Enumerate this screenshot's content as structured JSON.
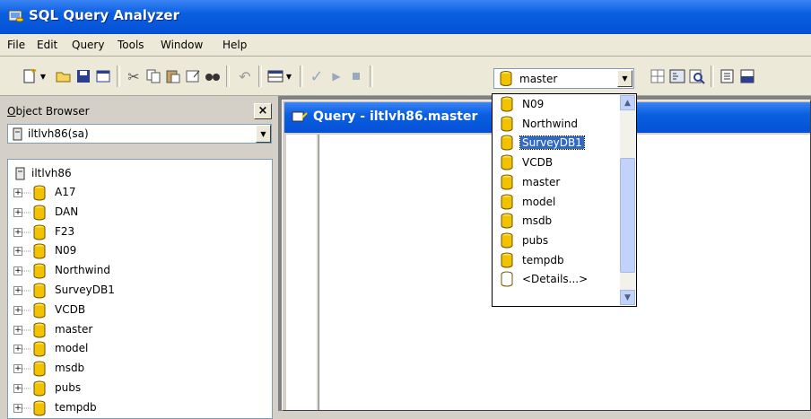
{
  "app": {
    "title": "SQL Query Analyzer"
  },
  "menu": [
    "File",
    "Edit",
    "Query",
    "Tools",
    "Window",
    "Help"
  ],
  "toolbar": {
    "database_selected": "master"
  },
  "object_browser": {
    "header": "Object Browser",
    "header_rest": "bject Browser",
    "header_access": "O",
    "server": "iltlvh86(sa)",
    "root": "iltlvh86",
    "databases": [
      "A17",
      "DAN",
      "F23",
      "N09",
      "Northwind",
      "SurveyDB1",
      "VCDB",
      "master",
      "model",
      "msdb",
      "pubs",
      "tempdb"
    ]
  },
  "query_window": {
    "title": "Query - iltlvh86.master"
  },
  "db_dropdown": {
    "items": [
      "N09",
      "Northwind",
      "SurveyDB1",
      "VCDB",
      "master",
      "model",
      "msdb",
      "pubs",
      "tempdb",
      "<Details...>"
    ],
    "selected": "SurveyDB1"
  },
  "colors": {
    "titlebar": "#0a5fe0",
    "highlight": "#316ac5",
    "db_icon": "#f2c200"
  }
}
